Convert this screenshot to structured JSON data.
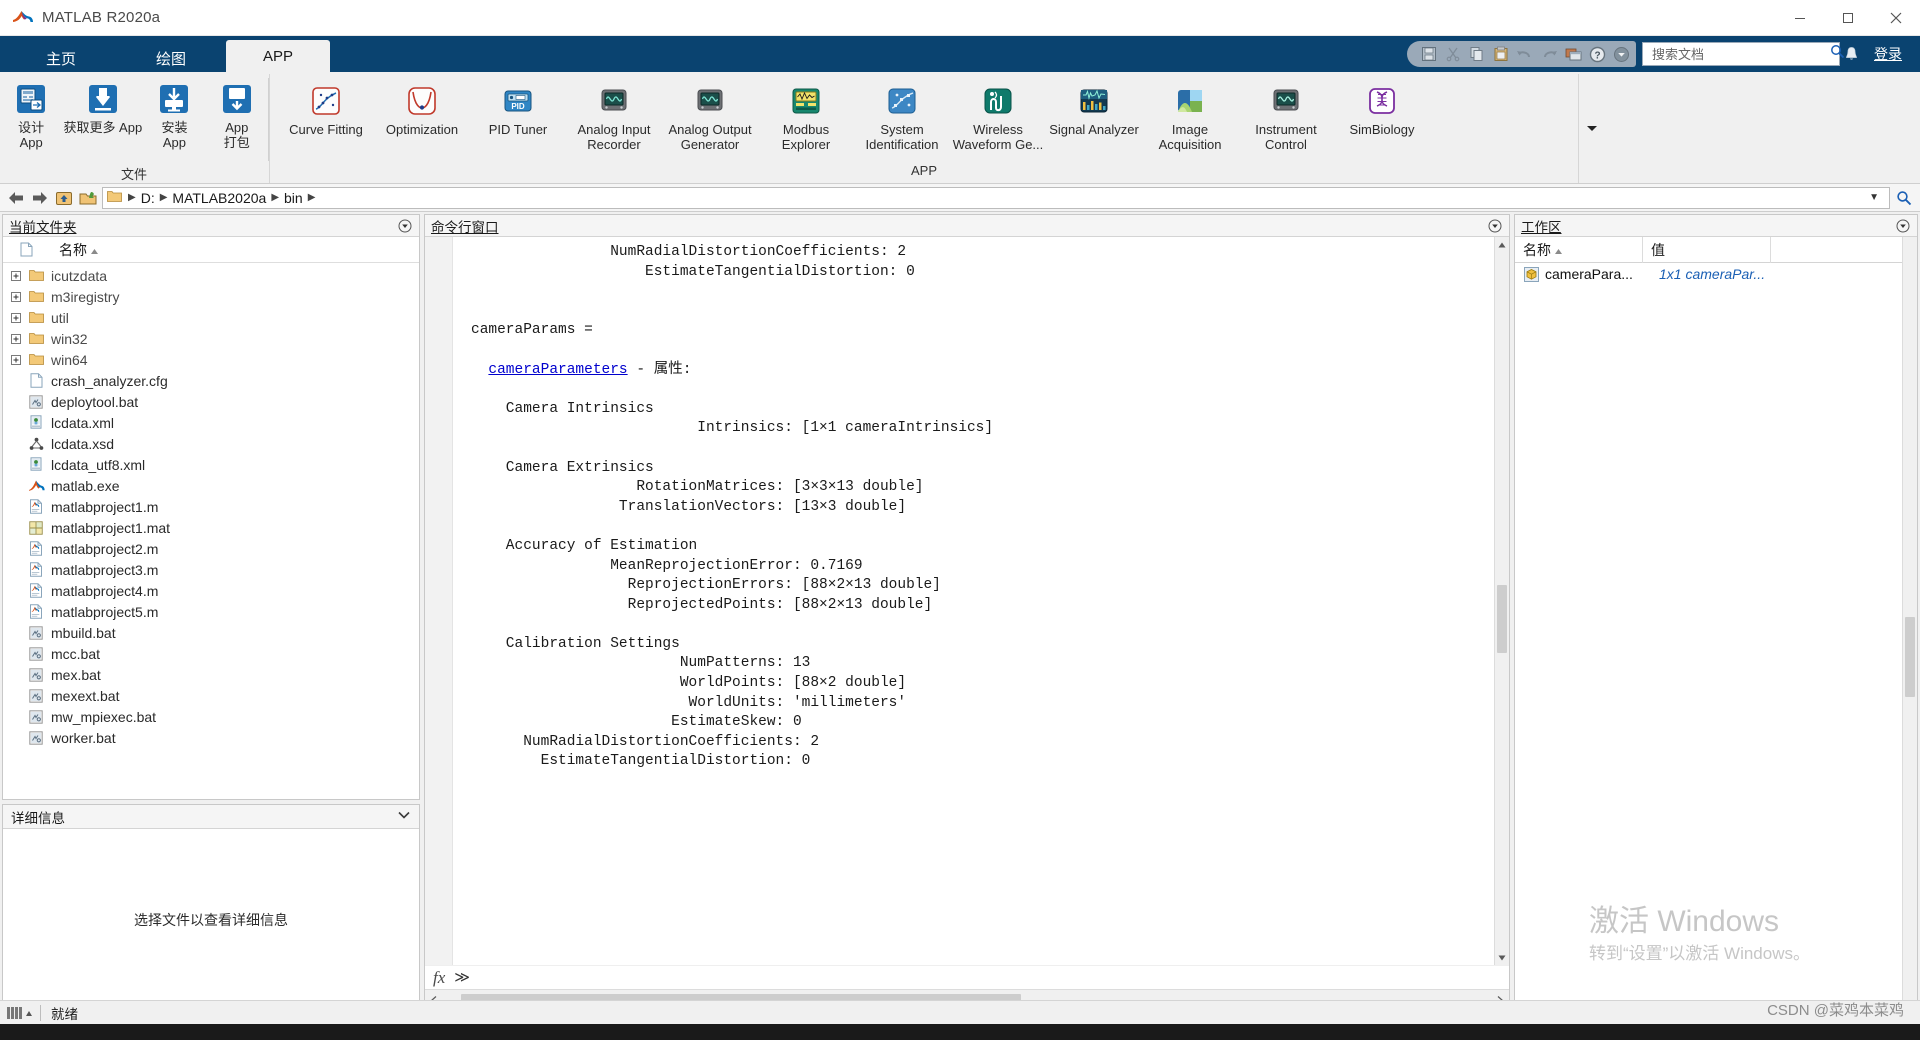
{
  "window": {
    "title": "MATLAB R2020a",
    "minimize_label": "─",
    "maximize_label": "☐",
    "close_label": "✕"
  },
  "tabs": [
    {
      "label": "主页",
      "active": false
    },
    {
      "label": "绘图",
      "active": false
    },
    {
      "label": "APP",
      "active": true
    }
  ],
  "quick_access": {
    "icons": [
      "save-icon",
      "cut-icon",
      "copy-icon",
      "paste-icon",
      "undo-icon",
      "redo-icon",
      "switch-window-icon",
      "help-icon",
      "customize-icon"
    ]
  },
  "search": {
    "placeholder": "搜索文档",
    "value": "",
    "icon": "search-icon"
  },
  "notifications": {
    "icon": "bell-icon"
  },
  "login": {
    "label": "登录"
  },
  "ribbon": {
    "file_group": {
      "label": "文件",
      "buttons": [
        {
          "label": "设计\nApp",
          "icon": "design-app-icon"
        },
        {
          "label": "获取更多 App",
          "icon": "get-more-apps-icon"
        },
        {
          "label": "安装\nApp",
          "icon": "install-app-icon"
        },
        {
          "label": "App\n打包",
          "icon": "package-app-icon"
        }
      ]
    },
    "app_group": {
      "label": "APP",
      "buttons": [
        {
          "label": "Curve Fitting",
          "icon": "curve-fitting-icon"
        },
        {
          "label": "Optimization",
          "icon": "optimization-icon"
        },
        {
          "label": "PID Tuner",
          "icon": "pid-tuner-icon"
        },
        {
          "label": "Analog Input Recorder",
          "icon": "analog-input-recorder-icon"
        },
        {
          "label": "Analog Output Generator",
          "icon": "analog-output-generator-icon"
        },
        {
          "label": "Modbus Explorer",
          "icon": "modbus-explorer-icon"
        },
        {
          "label": "System Identification",
          "icon": "system-identification-icon"
        },
        {
          "label": "Wireless Waveform Ge...",
          "icon": "wireless-waveform-icon"
        },
        {
          "label": "Signal Analyzer",
          "icon": "signal-analyzer-icon"
        },
        {
          "label": "Image Acquisition",
          "icon": "image-acquisition-icon"
        },
        {
          "label": "Instrument Control",
          "icon": "instrument-control-icon"
        },
        {
          "label": "SimBiology",
          "icon": "simbiology-icon"
        }
      ]
    },
    "expand": {
      "icon": "chevron-down-icon"
    }
  },
  "address_bar": {
    "back_icon": "arrow-left-icon",
    "forward_icon": "arrow-right-icon",
    "up_icon": "folder-up-icon",
    "browse_icon": "browse-folder-icon",
    "folder_icon": "folder-icon",
    "crumbs": [
      "D:",
      "MATLAB2020a",
      "bin"
    ],
    "dropdown_icon": "chevron-down-icon",
    "search_icon": "search-icon"
  },
  "current_folder": {
    "title": "当前文件夹",
    "caret_icon": "panel-menu-icon",
    "columns": [
      {
        "label": "",
        "icon": "file-icon"
      },
      {
        "label": "名称",
        "sort_icon": "sort-asc-icon"
      }
    ],
    "items": [
      {
        "name": "icutzdata",
        "type": "folder",
        "expandable": true
      },
      {
        "name": "m3iregistry",
        "type": "folder",
        "expandable": true
      },
      {
        "name": "util",
        "type": "folder",
        "expandable": true
      },
      {
        "name": "win32",
        "type": "folder",
        "expandable": true
      },
      {
        "name": "win64",
        "type": "folder",
        "expandable": true
      },
      {
        "name": "crash_analyzer.cfg",
        "type": "file",
        "expandable": false
      },
      {
        "name": "deploytool.bat",
        "type": "bat",
        "expandable": false
      },
      {
        "name": "lcdata.xml",
        "type": "xml",
        "expandable": false
      },
      {
        "name": "lcdata.xsd",
        "type": "xsd",
        "expandable": false
      },
      {
        "name": "lcdata_utf8.xml",
        "type": "xml",
        "expandable": false
      },
      {
        "name": "matlab.exe",
        "type": "exe",
        "expandable": false
      },
      {
        "name": "matlabproject1.m",
        "type": "m",
        "expandable": false
      },
      {
        "name": "matlabproject1.mat",
        "type": "mat",
        "expandable": false
      },
      {
        "name": "matlabproject2.m",
        "type": "m",
        "expandable": false
      },
      {
        "name": "matlabproject3.m",
        "type": "m",
        "expandable": false
      },
      {
        "name": "matlabproject4.m",
        "type": "m",
        "expandable": false
      },
      {
        "name": "matlabproject5.m",
        "type": "m",
        "expandable": false
      },
      {
        "name": "mbuild.bat",
        "type": "bat",
        "expandable": false
      },
      {
        "name": "mcc.bat",
        "type": "bat",
        "expandable": false
      },
      {
        "name": "mex.bat",
        "type": "bat",
        "expandable": false
      },
      {
        "name": "mexext.bat",
        "type": "bat",
        "expandable": false
      },
      {
        "name": "mw_mpiexec.bat",
        "type": "bat",
        "expandable": false
      },
      {
        "name": "worker.bat",
        "type": "bat",
        "expandable": false
      }
    ]
  },
  "details": {
    "title": "详细信息",
    "caret_icon": "chevron-down-icon",
    "empty_message": "选择文件以查看详细信息"
  },
  "command_window": {
    "title": "命令行窗口",
    "caret_icon": "panel-menu-icon",
    "output_before_link": "                NumRadialDistortionCoefficients: 2\n                    EstimateTangentialDistortion: 0\n\n\ncameraParams =\n\n  ",
    "link_text": "cameraParameters",
    "output_after_link": " - 属性:\n\n    Camera Intrinsics\n                          Intrinsics: [1×1 cameraIntrinsics]\n\n    Camera Extrinsics\n                   RotationMatrices: [3×3×13 double]\n                 TranslationVectors: [13×3 double]\n\n    Accuracy of Estimation\n                MeanReprojectionError: 0.7169\n                  ReprojectionErrors: [88×2×13 double]\n                  ReprojectedPoints: [88×2×13 double]\n\n    Calibration Settings\n                        NumPatterns: 13\n                        WorldPoints: [88×2 double]\n                         WorldUnits: 'millimeters'\n                       EstimateSkew: 0\n      NumRadialDistortionCoefficients: 2\n        EstimateTangentialDistortion: 0\n",
    "prompt": {
      "fx_label": "fx",
      "chevron": "≫",
      "input_value": ""
    },
    "scroll": {
      "up_icon": "▲",
      "down_icon": "▼",
      "left_icon": "‹",
      "right_icon": "›"
    }
  },
  "workspace": {
    "title": "工作区",
    "caret_icon": "panel-menu-icon",
    "columns": [
      "名称",
      "值",
      ""
    ],
    "sort_icon": "sort-asc-icon",
    "rows": [
      {
        "icon": "object-variable-icon",
        "name": "cameraPara...",
        "value": "1x1 cameraPar..."
      }
    ]
  },
  "watermark": {
    "line1": "激活 Windows",
    "line2": "转到“设置”以激活 Windows。"
  },
  "status_bar": {
    "busy_icon": "busy-indicator-icon",
    "text": "就绪"
  },
  "credit": "CSDN @菜鸡本菜鸡",
  "colors": {
    "ribbon_blue": "#0a4370",
    "panel_bg": "#f0f0f0",
    "link_blue": "#0000cd",
    "value_blue": "#1a5fb4"
  }
}
